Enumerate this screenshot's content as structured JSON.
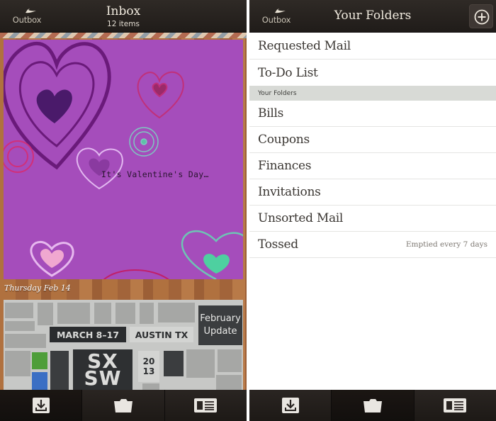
{
  "brand": {
    "logo_text": "Outbox"
  },
  "inbox_screen": {
    "title": "Inbox",
    "subtitle": "12 items",
    "mail_items": [
      {
        "card_text": "It's Valentine's Day…",
        "date": "Thursday Feb 14",
        "card_color": "#a54dbb"
      },
      {
        "badge_dates": "MARCH 8–17",
        "badge_place": "AUSTIN TX",
        "badge_update_line1": "February",
        "badge_update_line2": "Update",
        "logo_line1": "SX",
        "logo_line2": "SW",
        "year_line1": "20",
        "year_line2": "13"
      }
    ]
  },
  "folders_screen": {
    "title": "Your Folders",
    "add_button": "add-folder",
    "pinned_folders": [
      {
        "name": "Requested Mail"
      },
      {
        "name": "To-Do List"
      }
    ],
    "section_header": "Your Folders",
    "folders": [
      {
        "name": "Bills",
        "note": ""
      },
      {
        "name": "Coupons",
        "note": ""
      },
      {
        "name": "Finances",
        "note": ""
      },
      {
        "name": "Invitations",
        "note": ""
      },
      {
        "name": "Unsorted Mail",
        "note": ""
      },
      {
        "name": "Tossed",
        "note": "Emptied every 7 days"
      }
    ]
  },
  "bottom_nav": {
    "tabs": [
      {
        "icon": "inbox-download-icon"
      },
      {
        "icon": "folder-icon"
      },
      {
        "icon": "news-reader-icon"
      }
    ],
    "left_active": 0,
    "right_active": 1
  },
  "colors": {
    "topbar": "#2a2522",
    "title_text": "#f1ebdf",
    "list_text": "#3b3733",
    "section_bg": "#d8dad6"
  }
}
